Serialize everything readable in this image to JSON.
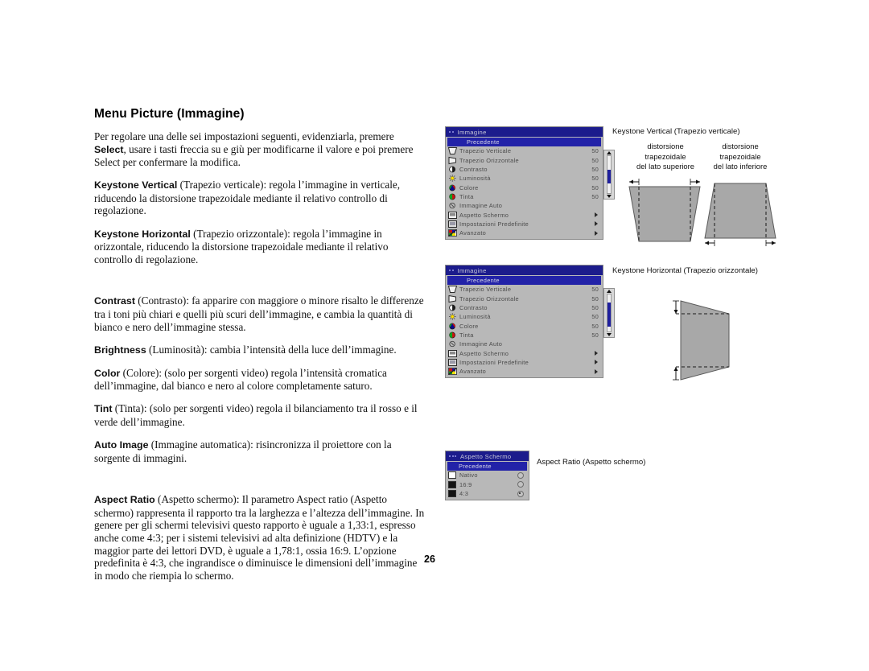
{
  "document": {
    "title": "Menu Picture (Immagine)",
    "page_number": "26"
  },
  "body_text": {
    "intro": {
      "line1": "Per regolare una delle sei impostazioni seguenti, evidenziarla, premere",
      "bold1": "Select",
      "line2": ", usare i tasti freccia su e giù per modificarne il valore e poi premere",
      "line3": "Select per confermare la modifica."
    },
    "entries": [
      {
        "term": "Keystone Vertical",
        "text": " (Trapezio verticale): regola l’immagine in verticale, riducendo la distorsione trapezoidale mediante il relativo controllo di regolazione."
      },
      {
        "term": "Keystone Horizontal",
        "text": " (Trapezio orizzontale): regola l’immagine in orizzontale, riducendo la distorsione trapezoidale mediante il relativo controllo di regolazione."
      },
      {
        "term": "Contrast",
        "text": " (Contrasto): fa apparire con maggiore o minore risalto le differenze tra i toni più chiari e quelli più scuri dell’immagine, e cambia la quantità di bianco e nero dell’immagine stessa."
      },
      {
        "term": "Brightness",
        "text": " (Luminosità): cambia l’intensità della luce dell’immagine."
      },
      {
        "term": "Color",
        "text": " (Colore): (solo per sorgenti video) regola l’intensità cromatica dell’immagine, dal bianco e nero al colore completamente saturo."
      },
      {
        "term": "Tint",
        "text": " (Tinta): (solo per sorgenti video) regola il bilanciamento tra il rosso e il verde dell’immagine."
      },
      {
        "term": "Auto Image",
        "text": " (Immagine automatica): risincronizza il proiettore con la sorgente di immagini."
      },
      {
        "term": "Aspect Ratio",
        "text": " (Aspetto schermo): Il parametro Aspect ratio (Aspetto schermo) rappresenta il rapporto tra la larghezza e l’altezza dell’immagine. In genere per gli schermi televisivi questo rapporto è uguale a 1,33:1, espresso anche come 4:3; per i sistemi televisivi ad alta definizione (HDTV) e la maggior parte dei lettori DVD, è uguale a 1,78:1, ossia 16:9. L’opzione predefinita è 4:3, che ingrandisce o diminuisce le dimensioni dell’immagine in modo che riempia lo schermo."
      }
    ]
  },
  "picture_menu": {
    "title": "Immagine",
    "back_item": "Precedente",
    "items": [
      {
        "label": "Trapezio Verticale",
        "value": "50",
        "icon": "keystone-vertical-icon",
        "type": "value"
      },
      {
        "label": "Trapezio Orizzontale",
        "value": "50",
        "icon": "keystone-horizontal-icon",
        "type": "value"
      },
      {
        "label": "Contrasto",
        "value": "50",
        "icon": "contrast-icon",
        "type": "value"
      },
      {
        "label": "Luminosità",
        "value": "50",
        "icon": "brightness-icon",
        "type": "value"
      },
      {
        "label": "Colore",
        "value": "50",
        "icon": "color-icon",
        "type": "value"
      },
      {
        "label": "Tinta",
        "value": "50",
        "icon": "tint-icon",
        "type": "value"
      },
      {
        "label": "Immagine Auto",
        "value": "",
        "icon": "auto-image-icon",
        "type": "plain"
      },
      {
        "label": "Aspetto Schermo",
        "value": "",
        "icon": "aspect-ratio-icon",
        "type": "submenu"
      },
      {
        "label": "Impostazioni Predefinite",
        "value": "",
        "icon": "presets-icon",
        "type": "submenu"
      },
      {
        "label": "Avanzato",
        "value": "",
        "icon": "advanced-icon",
        "type": "submenu"
      }
    ]
  },
  "aspect_menu": {
    "title": "Aspetto Schermo",
    "back_item": "Precedente",
    "options": [
      {
        "label": "Nativo",
        "swatch": "#ffffff",
        "selected": false
      },
      {
        "label": "16:9",
        "swatch": "#141414",
        "selected": false
      },
      {
        "label": "4:3",
        "swatch": "#141414",
        "selected": true
      }
    ]
  },
  "figures": {
    "keystone_vertical": {
      "caption": "Keystone Vertical (Trapezio verticale)",
      "left_label": "distorsione\ntrapezoidale\ndel lato superiore",
      "left_label_l1": "distorsione",
      "left_label_l2": "trapezoidale",
      "left_label_l3": "del lato superiore",
      "right_label_l1": "distorsione",
      "right_label_l2": "trapezoidale",
      "right_label_l3": "del lato inferiore"
    },
    "keystone_horizontal": {
      "caption": "Keystone Horizontal (Trapezio orizzontale)"
    },
    "aspect_ratio": {
      "caption": "Aspect Ratio (Aspetto schermo)"
    }
  },
  "colors": {
    "menu_title_bar": "#1c1c8c",
    "menu_background": "#b8b8b8",
    "menu_highlight": "#2222a8",
    "scrollbar_thumb": "#1f1f9e",
    "figure_fill": "#a8a8a8"
  }
}
